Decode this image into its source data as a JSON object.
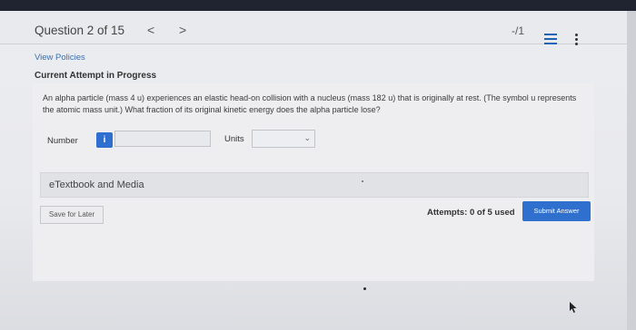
{
  "header": {
    "question_title": "Question 2 of 15",
    "prev_symbol": "<",
    "next_symbol": ">",
    "score": "-/1",
    "icons": [
      "list-icon",
      "more-options-icon"
    ]
  },
  "links": {
    "view_policies": "View Policies"
  },
  "status": {
    "attempt_status": "Current Attempt in Progress"
  },
  "question": {
    "text": "An alpha particle (mass 4 u) experiences an elastic head-on collision with a nucleus (mass 182 u) that is originally at rest. (The symbol u represents the atomic mass unit.) What fraction of its original kinetic energy does the alpha particle lose?"
  },
  "answer": {
    "number_label": "Number",
    "info_symbol": "i",
    "number_value": "",
    "units_label": "Units",
    "units_selected": ""
  },
  "resources": {
    "etextbook_label": "eTextbook and Media"
  },
  "footer": {
    "save_label": "Save for Later",
    "attempts_text": "Attempts: 0 of 5 used",
    "submit_label": "Submit Answer"
  },
  "colors": {
    "accent": "#2f6fce",
    "link": "#3a6fb0",
    "topbar": "#1f2430"
  }
}
